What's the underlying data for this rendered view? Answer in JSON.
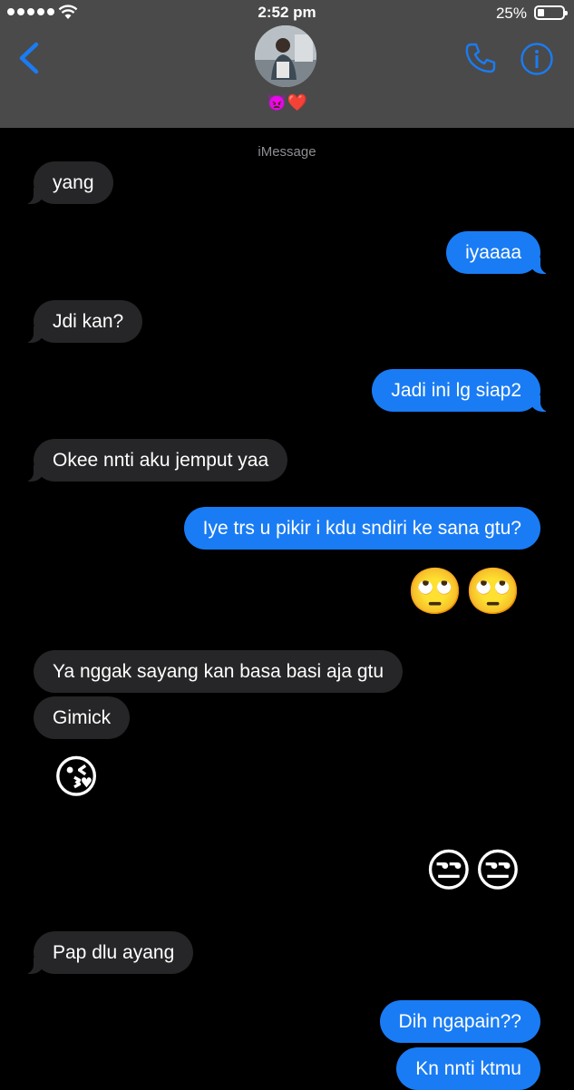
{
  "status": {
    "time": "2:52 pm",
    "battery": "25%",
    "battery_level": 0.25,
    "signal_bars": 5
  },
  "header": {
    "contact_name": "👿❤️"
  },
  "service_label": "iMessage",
  "messages": [
    {
      "dir": "in",
      "text": "yang"
    },
    {
      "dir": "out",
      "text": "iyaaaa"
    },
    {
      "dir": "in",
      "text": "Jdi kan?"
    },
    {
      "dir": "out",
      "text": "Jadi ini lg siap2"
    },
    {
      "dir": "in",
      "text": "Okee nnti aku jemput yaa"
    },
    {
      "dir": "out",
      "text": "Iye trs u pikir i kdu sndiri ke sana gtu?"
    },
    {
      "dir": "out",
      "text": "🙄🙄",
      "emoji": true
    },
    {
      "dir": "in",
      "text": "Ya nggak sayang kan basa basi aja gtu"
    },
    {
      "dir": "in",
      "text": "Gimick"
    },
    {
      "dir": "in",
      "text": "😘",
      "emoji": true
    },
    {
      "dir": "out",
      "text": "😒😒",
      "emoji": true
    },
    {
      "dir": "in",
      "text": "Pap dlu ayang"
    },
    {
      "dir": "out",
      "text": "Dih ngapain??"
    },
    {
      "dir": "out",
      "text": "Kn nnti ktmu"
    }
  ],
  "colors": {
    "header_bg": "#4a4a4a",
    "accent": "#1a7cf4",
    "incoming_bubble": "#262628",
    "outgoing_bubble": "#1a7cf4",
    "background": "#000000"
  },
  "icons": [
    "back-chevron-icon",
    "phone-icon",
    "info-icon",
    "wifi-icon",
    "battery-icon",
    "signal-dots-icon"
  ]
}
